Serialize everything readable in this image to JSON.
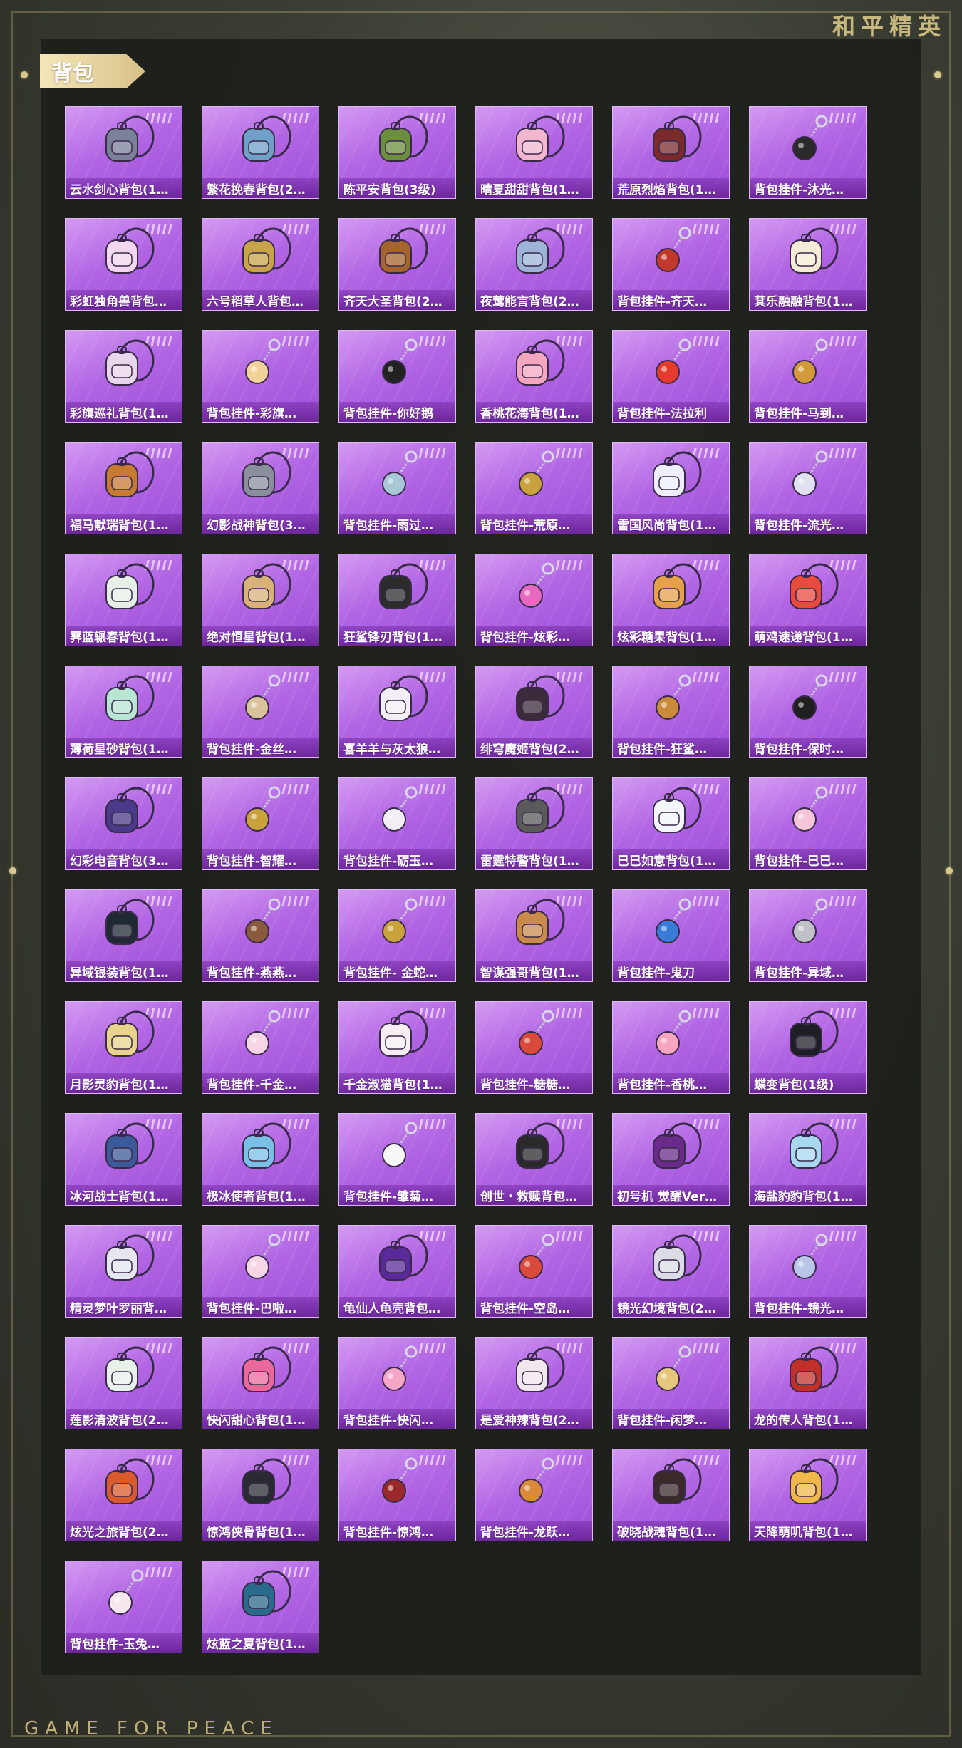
{
  "header": {
    "brand_title": "和平精英"
  },
  "section": {
    "title": "背包"
  },
  "footer": {
    "brand_text": "GAME FOR PEACE"
  },
  "items": [
    {
      "label": "云水剑心背包(1…",
      "icon": "backpack-icon",
      "color": "#7a7f9a"
    },
    {
      "label": "繁花挽春背包(2…",
      "icon": "backpack-icon",
      "color": "#6fa0c8"
    },
    {
      "label": "陈平安背包(3级)",
      "icon": "backpack-icon",
      "color": "#6b8f3c"
    },
    {
      "label": "晴夏甜甜背包(1…",
      "icon": "backpack-icon",
      "color": "#f3b6cf"
    },
    {
      "label": "荒原烈焰背包(1…",
      "icon": "backpack-icon",
      "color": "#7a2a2a"
    },
    {
      "label": "背包挂件-沐光…",
      "icon": "charm-icon",
      "color": "#2a2a2a"
    },
    {
      "label": "彩虹独角兽背包…",
      "icon": "backpack-icon",
      "color": "#f2d7ee"
    },
    {
      "label": "六号稻草人背包…",
      "icon": "backpack-icon",
      "color": "#c9a34a"
    },
    {
      "label": "齐天大圣背包(2…",
      "icon": "backpack-icon",
      "color": "#a5632d"
    },
    {
      "label": "夜莺能言背包(2…",
      "icon": "backpack-icon",
      "color": "#9db4d8"
    },
    {
      "label": "背包挂件-齐天…",
      "icon": "charm-icon",
      "color": "#c0392b"
    },
    {
      "label": "萁乐融融背包(1…",
      "icon": "backpack-icon",
      "color": "#f5ecd5"
    },
    {
      "label": "彩旗巡礼背包(1…",
      "icon": "backpack-icon",
      "color": "#e8d6ea"
    },
    {
      "label": "背包挂件-彩旗…",
      "icon": "charm-icon",
      "color": "#f1d39a"
    },
    {
      "label": "背包挂件-你好鹅",
      "icon": "charm-icon",
      "color": "#222222"
    },
    {
      "label": "香桃花海背包(1…",
      "icon": "backpack-icon",
      "color": "#f4a6c0"
    },
    {
      "label": "背包挂件-法拉利",
      "icon": "charm-icon",
      "color": "#e53b2c"
    },
    {
      "label": "背包挂件-马到…",
      "icon": "charm-icon",
      "color": "#d39a3c"
    },
    {
      "label": "福马献瑞背包(1…",
      "icon": "backpack-icon",
      "color": "#c77a30"
    },
    {
      "label": "幻影战神背包(3…",
      "icon": "backpack-icon",
      "color": "#8a8f9e"
    },
    {
      "label": "背包挂件-雨过…",
      "icon": "charm-icon",
      "color": "#a9c7d6"
    },
    {
      "label": "背包挂件-荒原…",
      "icon": "charm-icon",
      "color": "#c9a23c"
    },
    {
      "label": "雪国风尚背包(1…",
      "icon": "backpack-icon",
      "color": "#eeeeff"
    },
    {
      "label": "背包挂件-流光…",
      "icon": "charm-icon",
      "color": "#e0e0f0"
    },
    {
      "label": "霁蓝辗春背包(1…",
      "icon": "backpack-icon",
      "color": "#e6efe6"
    },
    {
      "label": "绝对恒星背包(1…",
      "icon": "backpack-icon",
      "color": "#d9b27a"
    },
    {
      "label": "狂鲨锋刃背包(1…",
      "icon": "backpack-icon",
      "color": "#2c2c2c"
    },
    {
      "label": "背包挂件-炫彩…",
      "icon": "charm-icon",
      "color": "#e86ac0"
    },
    {
      "label": "炫彩糖果背包(1…",
      "icon": "backpack-icon",
      "color": "#e6a04a"
    },
    {
      "label": "萌鸡速递背包(1…",
      "icon": "backpack-icon",
      "color": "#e84b3c"
    },
    {
      "label": "薄荷星砂背包(1…",
      "icon": "backpack-icon",
      "color": "#b9e6d4"
    },
    {
      "label": "背包挂件-金丝…",
      "icon": "charm-icon",
      "color": "#d9c39a"
    },
    {
      "label": "喜羊羊与灰太狼…",
      "icon": "backpack-icon",
      "color": "#f3eef5"
    },
    {
      "label": "绯穹魔姬背包(2…",
      "icon": "backpack-icon",
      "color": "#3a2a3a"
    },
    {
      "label": "背包挂件-狂鲨…",
      "icon": "charm-icon",
      "color": "#c98a3c"
    },
    {
      "label": "背包挂件-保时…",
      "icon": "charm-icon",
      "color": "#1f1f1f"
    },
    {
      "label": "幻彩电音背包(3…",
      "icon": "backpack-icon",
      "color": "#4a3a8a"
    },
    {
      "label": "背包挂件-智耀…",
      "icon": "charm-icon",
      "color": "#c9a23c"
    },
    {
      "label": "背包挂件-砺玉…",
      "icon": "charm-icon",
      "color": "#f3eef5"
    },
    {
      "label": "雷霆特警背包(1…",
      "icon": "backpack-icon",
      "color": "#5a5a5a"
    },
    {
      "label": "巳巳如意背包(1…",
      "icon": "backpack-icon",
      "color": "#f3f6fb"
    },
    {
      "label": "背包挂件-巳巳…",
      "icon": "charm-icon",
      "color": "#f6c6d8"
    },
    {
      "label": "异域银装背包(1…",
      "icon": "backpack-icon",
      "color": "#1e2a33"
    },
    {
      "label": "背包挂件-燕燕…",
      "icon": "charm-icon",
      "color": "#8a5a3c"
    },
    {
      "label": "背包挂件- 金蛇…",
      "icon": "charm-icon",
      "color": "#c9a23c"
    },
    {
      "label": "智谋强哥背包(1…",
      "icon": "backpack-icon",
      "color": "#c98a4a"
    },
    {
      "label": "背包挂件-鬼刀",
      "icon": "charm-icon",
      "color": "#3a7ad9"
    },
    {
      "label": "背包挂件-异域…",
      "icon": "charm-icon",
      "color": "#c0c0c8"
    },
    {
      "label": "月影灵豹背包(1…",
      "icon": "backpack-icon",
      "color": "#e8d38a"
    },
    {
      "label": "背包挂件-千金…",
      "icon": "charm-icon",
      "color": "#f6d6e6"
    },
    {
      "label": "千金淑猫背包(1…",
      "icon": "backpack-icon",
      "color": "#f6eef3"
    },
    {
      "label": "背包挂件-糖糖…",
      "icon": "charm-icon",
      "color": "#d94a3c"
    },
    {
      "label": "背包挂件-香桃…",
      "icon": "charm-icon",
      "color": "#f6a6c0"
    },
    {
      "label": "蝶变背包(1级)",
      "icon": "backpack-icon",
      "color": "#1e1e26"
    },
    {
      "label": "冰河战士背包(1…",
      "icon": "backpack-icon",
      "color": "#3a5a9a"
    },
    {
      "label": "极冰使者背包(1…",
      "icon": "backpack-icon",
      "color": "#7ac0e6"
    },
    {
      "label": "背包挂件-雏菊…",
      "icon": "charm-icon",
      "color": "#f6f6f6"
    },
    {
      "label": "创世・救赎背包…",
      "icon": "backpack-icon",
      "color": "#2a2a2a"
    },
    {
      "label": "初号机 觉醒Ver…",
      "icon": "backpack-icon",
      "color": "#6a2a8a"
    },
    {
      "label": "海盐豹豹背包(1…",
      "icon": "backpack-icon",
      "color": "#a8d8ef"
    },
    {
      "label": "精灵梦叶罗丽背…",
      "icon": "backpack-icon",
      "color": "#e6e6f0"
    },
    {
      "label": "背包挂件-巴啦…",
      "icon": "charm-icon",
      "color": "#f6d6e6"
    },
    {
      "label": "龟仙人龟壳背包…",
      "icon": "backpack-icon",
      "color": "#5a2a9a"
    },
    {
      "label": "背包挂件-空岛…",
      "icon": "charm-icon",
      "color": "#d94a3c"
    },
    {
      "label": "镜光幻境背包(2…",
      "icon": "backpack-icon",
      "color": "#dcdce6"
    },
    {
      "label": "背包挂件-镜光…",
      "icon": "charm-icon",
      "color": "#b9c6ea"
    },
    {
      "label": "莲影清波背包(2…",
      "icon": "backpack-icon",
      "color": "#e8f0ea"
    },
    {
      "label": "快闪甜心背包(1…",
      "icon": "backpack-icon",
      "color": "#e96a9a"
    },
    {
      "label": "背包挂件-快闪…",
      "icon": "charm-icon",
      "color": "#f6a6c6"
    },
    {
      "label": "是爱神辣背包(2…",
      "icon": "backpack-icon",
      "color": "#f0e6ee"
    },
    {
      "label": "背包挂件-闲梦…",
      "icon": "charm-icon",
      "color": "#e6c67a"
    },
    {
      "label": "龙的传人背包(1…",
      "icon": "backpack-icon",
      "color": "#c0302a"
    },
    {
      "label": "炫光之旅背包(2…",
      "icon": "backpack-icon",
      "color": "#d95a2c"
    },
    {
      "label": "惊鸿侠骨背包(1…",
      "icon": "backpack-icon",
      "color": "#2a2a33"
    },
    {
      "label": "背包挂件-惊鸿…",
      "icon": "charm-icon",
      "color": "#9a2a2a"
    },
    {
      "label": "背包挂件-龙跃…",
      "icon": "charm-icon",
      "color": "#d98a3c"
    },
    {
      "label": "破晓战魂背包(1…",
      "icon": "backpack-icon",
      "color": "#3a2a2a"
    },
    {
      "label": "天降萌叽背包(1…",
      "icon": "backpack-icon",
      "color": "#f0b84a"
    },
    {
      "label": "背包挂件-玉兔…",
      "icon": "charm-icon",
      "color": "#f6e6ee"
    },
    {
      "label": "炫蓝之夏背包(1…",
      "icon": "backpack-icon",
      "color": "#2a6a8a"
    }
  ]
}
